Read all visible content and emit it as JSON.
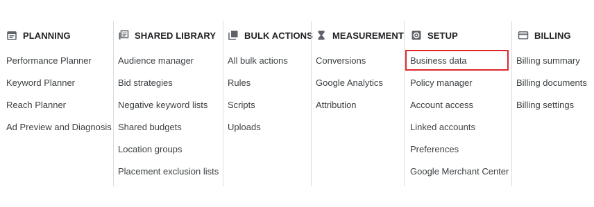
{
  "columns": [
    {
      "title": "PLANNING",
      "icon": "calendar-icon",
      "items": [
        "Performance Planner",
        "Keyword Planner",
        "Reach Planner",
        "Ad Preview and Diagnosis"
      ]
    },
    {
      "title": "SHARED LIBRARY",
      "icon": "library-icon",
      "items": [
        "Audience manager",
        "Bid strategies",
        "Negative keyword lists",
        "Shared budgets",
        "Location groups",
        "Placement exclusion lists"
      ]
    },
    {
      "title": "BULK ACTIONS",
      "icon": "copy-stack-icon",
      "items": [
        "All bulk actions",
        "Rules",
        "Scripts",
        "Uploads"
      ]
    },
    {
      "title": "MEASUREMENT",
      "icon": "hourglass-icon",
      "items": [
        "Conversions",
        "Google Analytics",
        "Attribution"
      ]
    },
    {
      "title": "SETUP",
      "icon": "settings-gear-icon",
      "items": [
        "Business data",
        "Policy manager",
        "Account access",
        "Linked accounts",
        "Preferences",
        "Google Merchant Center"
      ]
    },
    {
      "title": "BILLING",
      "icon": "credit-card-icon",
      "items": [
        "Billing summary",
        "Billing documents",
        "Billing settings"
      ]
    }
  ],
  "highlighted_item": "Business data",
  "colors": {
    "highlight_border": "#e0272c",
    "divider": "#dadce0",
    "text": "#3c4043",
    "header_text": "#202124",
    "icon": "#5f6368"
  }
}
